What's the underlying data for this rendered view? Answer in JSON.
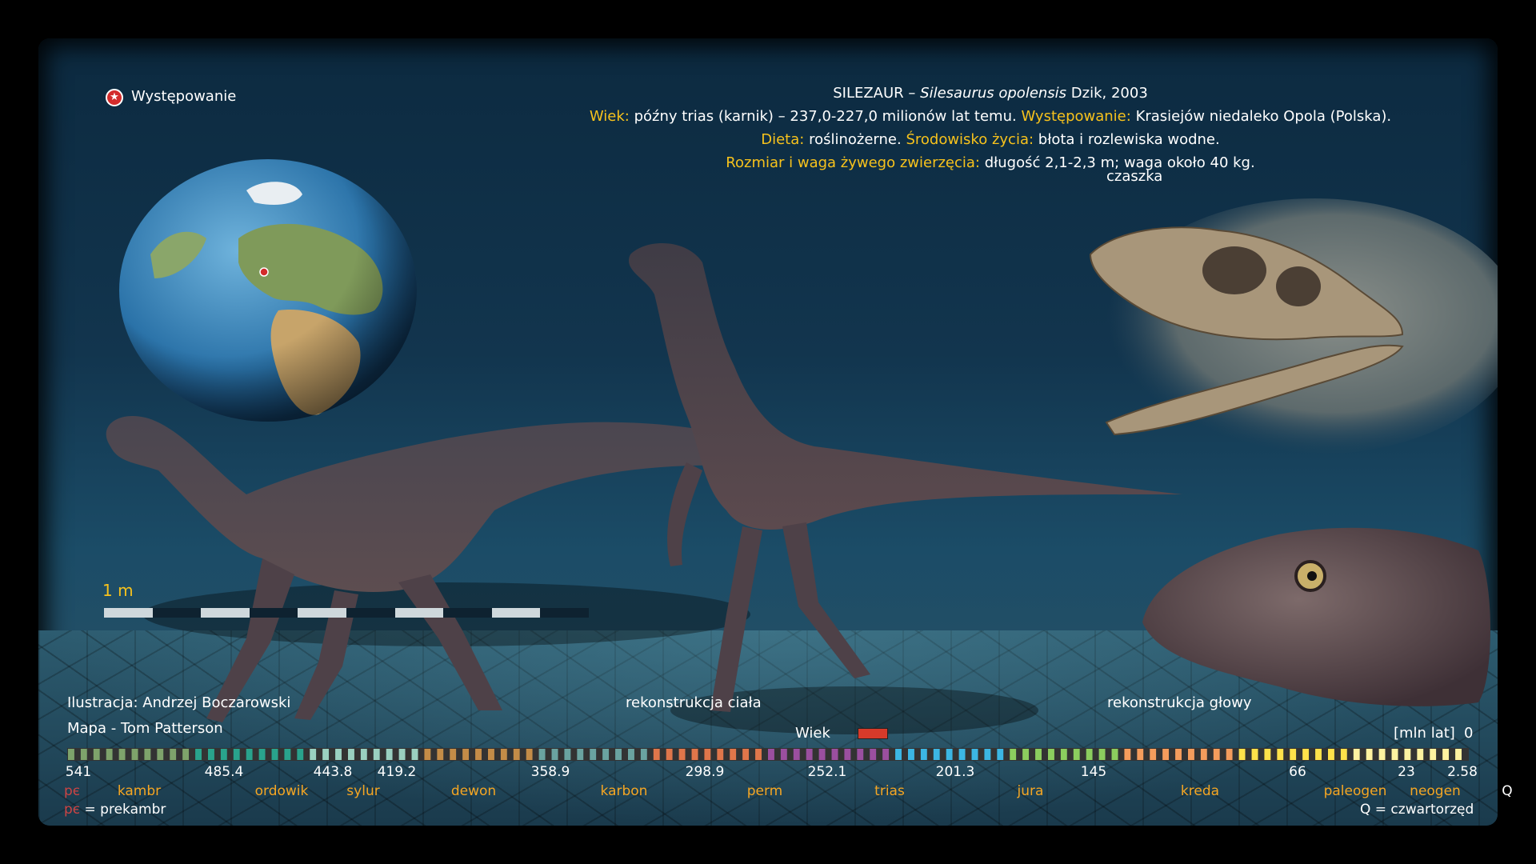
{
  "legend": {
    "occurrence_label": "Występowanie",
    "star_icon": "star-icon"
  },
  "header": {
    "name": "SILEZAUR",
    "dash": "–",
    "species": "Silesaurus  opolensis",
    "author": "Dzik,  2003",
    "age_label": "Wiek:",
    "age_value": "późny trias (karnik) – 237,0-227,0 milionów lat temu.",
    "occurrence_label": "Występowanie:",
    "occurrence_value": "Krasiejów niedaleko Opola (Polska).",
    "diet_label": "Dieta:",
    "diet_value": "roślinożerne.",
    "habitat_label": "Środowisko życia:",
    "habitat_value": "błota i rozlewiska wodne.",
    "size_label": "Rozmiar i waga żywego zwierzęcia:",
    "size_value": "długość 2,1-2,3 m; waga około 40 kg."
  },
  "captions": {
    "skull": "czaszka",
    "body": "rekonstrukcja ciała",
    "head": "rekonstrukcja głowy",
    "illustration": "Ilustracja: Andrzej Boczarowski",
    "map": "Mapa - Tom Patterson"
  },
  "scale": {
    "label": "1 m"
  },
  "timeline": {
    "age_label": "Wiek",
    "unit_label": "[mln lat]",
    "zero": "0",
    "ticks": [
      "541",
      "485.4",
      "443.8",
      "419.2",
      "358.9",
      "298.9",
      "252.1",
      "201.3",
      "145",
      "66",
      "23",
      "2.58"
    ],
    "periods": [
      "kambr",
      "ordowik",
      "sylur",
      "dewon",
      "karbon",
      "perm",
      "trias",
      "jura",
      "kreda",
      "paleogen",
      "neogen",
      "Q"
    ],
    "precambrian_abbr": "pє",
    "precambrian_legend": "= prekambr",
    "quaternary_legend": "Q = czwartorzęd"
  },
  "colors": {
    "accent": "#f7c21c",
    "age_marker": "#d63a2a",
    "period_text": "#f5a623"
  }
}
